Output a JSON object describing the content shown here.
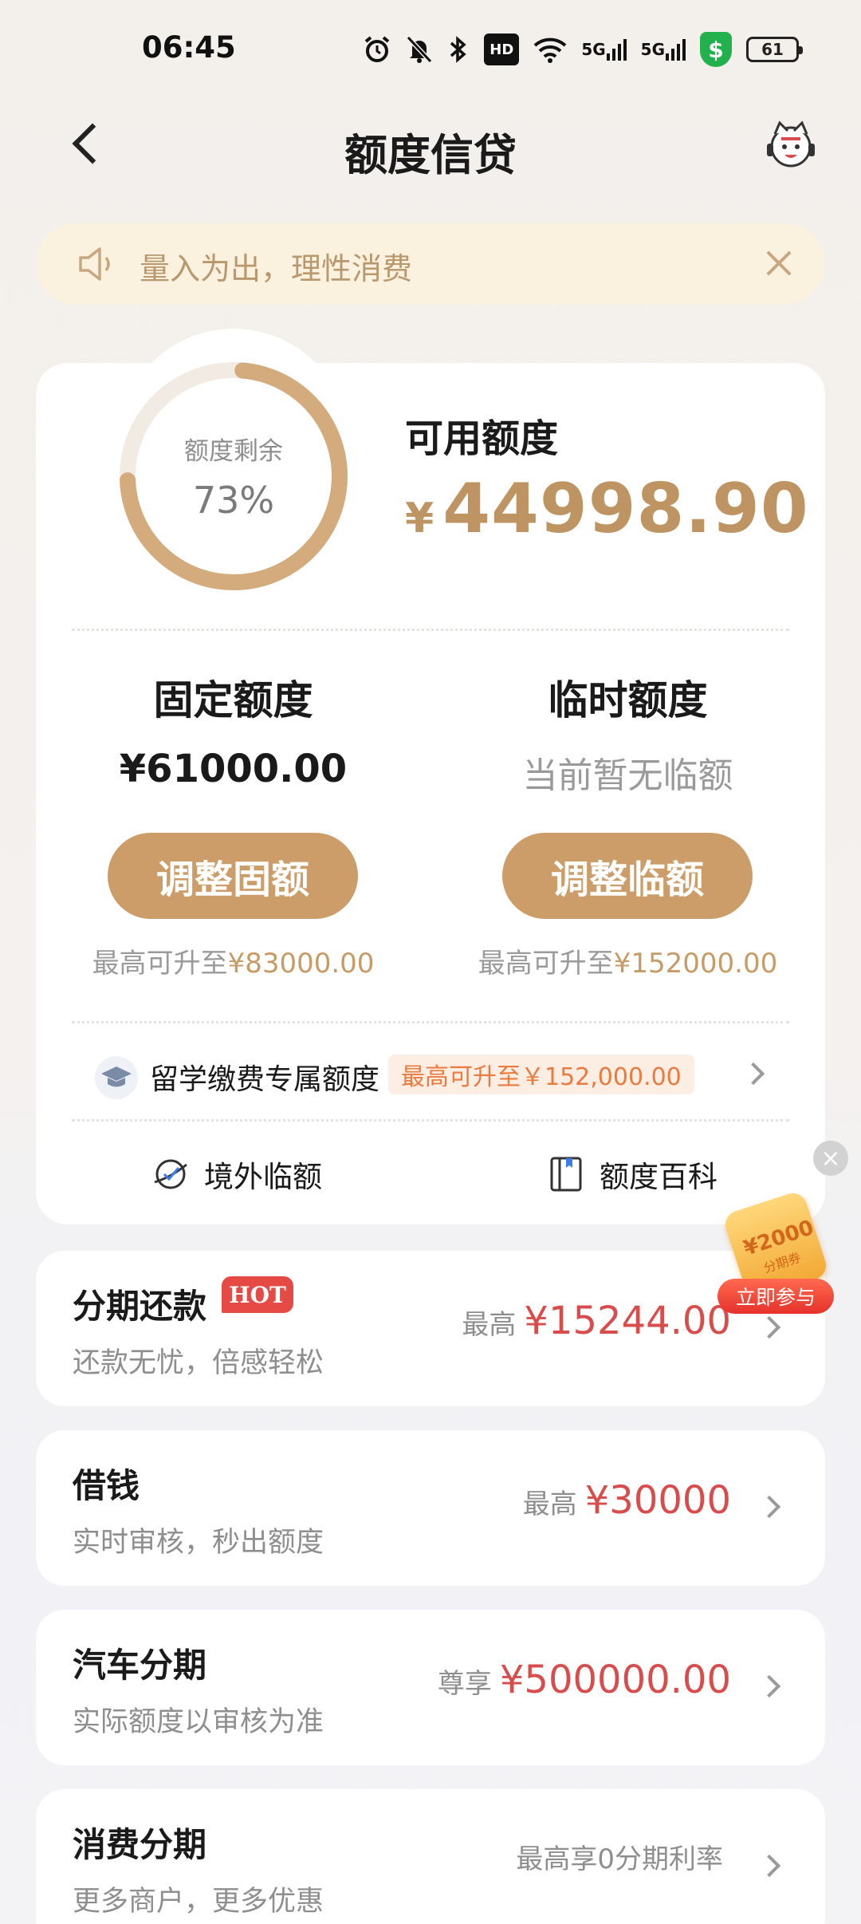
{
  "status_bar": {
    "time": "06:45",
    "hd_label": "HD",
    "net_1": "5G",
    "net_2": "5G",
    "battery": "61"
  },
  "header": {
    "title": "额度信贷"
  },
  "notice": {
    "text": "量入为出，理性消费"
  },
  "summary": {
    "ring_label": "额度剩余",
    "ring_percent": "73%",
    "ring_fraction": 0.73,
    "available_label": "可用额度",
    "available_currency": "¥",
    "available_value": "44998.90"
  },
  "fixed": {
    "title": "固定额度",
    "value": "¥61000.00",
    "button": "调整固额",
    "note_prefix": "最高可升至",
    "note_value": "¥83000.00"
  },
  "temp": {
    "title": "临时额度",
    "value": "当前暂无临额",
    "button": "调整临额",
    "note_prefix": "最高可升至",
    "note_value": "¥152000.00"
  },
  "study": {
    "label": "留学缴费专属额度",
    "tag": "最高可升至￥152,000.00"
  },
  "links": {
    "overseas": "境外临额",
    "wiki": "额度百科"
  },
  "promo": {
    "coupon_amount": "¥2000",
    "coupon_sub": "分期券",
    "button": "立即参与"
  },
  "products": [
    {
      "name": "分期还款",
      "badge": "HOT",
      "desc": "还款无忧，倍感轻松",
      "prefix": "最高",
      "amount": "¥15244.00"
    },
    {
      "name": "借钱",
      "desc": "实时审核，秒出额度",
      "prefix": "最高",
      "amount": "¥30000"
    },
    {
      "name": "汽车分期",
      "desc": "实际额度以审核为准",
      "prefix": "尊享",
      "amount": "¥500000.00"
    },
    {
      "name": "消费分期",
      "desc": "更多商户，更多优惠",
      "prefix": "最高享0分期利率",
      "amount": ""
    }
  ],
  "colors": {
    "accent_gold": "#cc9d68",
    "amount_red": "#d94c4c",
    "ring_track": "#f2ebe3"
  }
}
